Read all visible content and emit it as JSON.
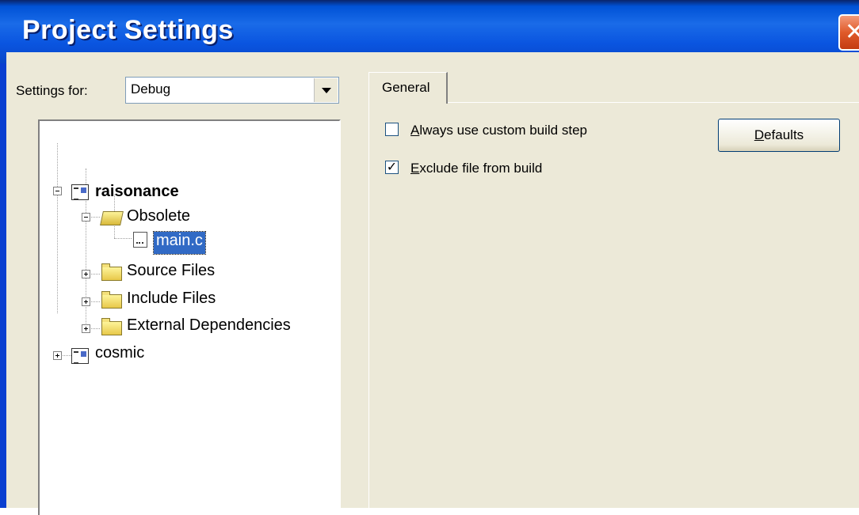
{
  "window": {
    "title": "Project Settings",
    "close_glyph": "✕"
  },
  "settings_for": {
    "label": "Settings for:",
    "value": "Debug"
  },
  "tree": {
    "items": [
      {
        "label": "raisonance",
        "icon": "project-icon"
      },
      {
        "label": "Obsolete",
        "icon": "folder-open-icon"
      },
      {
        "label": "main.c",
        "icon": "file-icon",
        "selected": true
      },
      {
        "label": "Source Files",
        "icon": "folder-icon"
      },
      {
        "label": "Include Files",
        "icon": "folder-icon"
      },
      {
        "label": "External Dependencies",
        "icon": "folder-icon"
      },
      {
        "label": "cosmic",
        "icon": "project-icon"
      }
    ]
  },
  "tabs": [
    {
      "label": "General"
    }
  ],
  "general": {
    "custom_build": {
      "label_u": "A",
      "label_rest": "lways use custom build step",
      "checked": false
    },
    "exclude": {
      "label_u": "E",
      "label_rest": "xclude file from build",
      "checked": true,
      "check_glyph": "✓"
    },
    "defaults_u": "D",
    "defaults_rest": "efaults"
  }
}
